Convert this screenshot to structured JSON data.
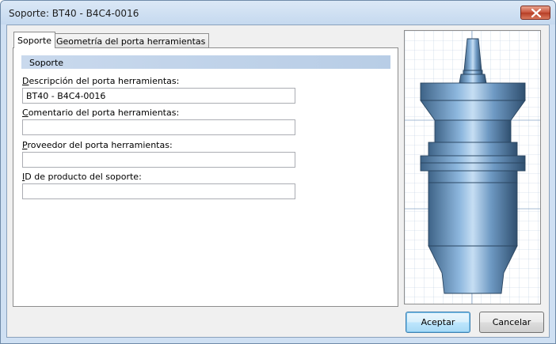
{
  "window": {
    "title": "Soporte: BT40 - B4C4-0016"
  },
  "tabs": [
    {
      "label": "Soporte",
      "active": true
    },
    {
      "label": "Geometría del porta herramientas",
      "active": false
    }
  ],
  "section": {
    "title": "Soporte"
  },
  "fields": {
    "description": {
      "label": "Descripción del porta herramientas:",
      "accel": "D",
      "rest": "escripción del porta herramientas:",
      "value": "BT40 - B4C4-0016"
    },
    "comment": {
      "label": "Comentario del porta herramientas:",
      "accel": "C",
      "rest": "omentario del porta herramientas:",
      "value": ""
    },
    "supplier": {
      "label": "Proveedor del porta herramientas:",
      "accel": "P",
      "rest": "roveedor del porta herramientas:",
      "value": ""
    },
    "product_id": {
      "label": "ID de producto del soporte:",
      "accel": "I",
      "rest": "D de producto del soporte:",
      "value": ""
    }
  },
  "buttons": {
    "accept": "Aceptar",
    "cancel": "Cancelar"
  },
  "colors": {
    "holder_body": "#6f9ac4",
    "holder_dark": "#2a4560",
    "grid": "#9fb8d4"
  }
}
